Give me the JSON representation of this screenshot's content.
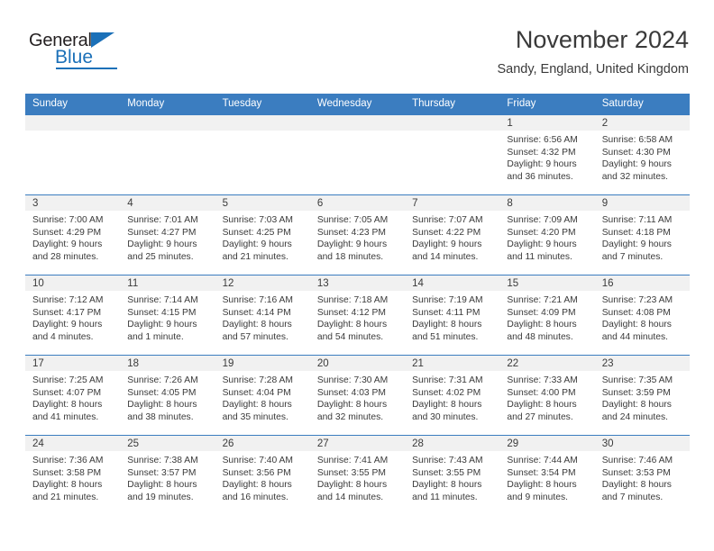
{
  "brand": {
    "name_top": "General",
    "name_bottom": "Blue",
    "accent_color": "#1b70b8",
    "triangle_icon": "blue-triangle-icon"
  },
  "header": {
    "title": "November 2024",
    "subtitle": "Sandy, England, United Kingdom"
  },
  "theme": {
    "header_bg": "#3b7dc0",
    "daynum_bg": "#f1f1f1",
    "text_color": "#3a3a3a",
    "row_divider": "#3b7dc0"
  },
  "weekday_headers": [
    "Sunday",
    "Monday",
    "Tuesday",
    "Wednesday",
    "Thursday",
    "Friday",
    "Saturday"
  ],
  "weeks": [
    [
      {
        "day": "",
        "sunrise": "",
        "sunset": "",
        "daylight_line1": "",
        "daylight_line2": "",
        "empty": true
      },
      {
        "day": "",
        "sunrise": "",
        "sunset": "",
        "daylight_line1": "",
        "daylight_line2": "",
        "empty": true
      },
      {
        "day": "",
        "sunrise": "",
        "sunset": "",
        "daylight_line1": "",
        "daylight_line2": "",
        "empty": true
      },
      {
        "day": "",
        "sunrise": "",
        "sunset": "",
        "daylight_line1": "",
        "daylight_line2": "",
        "empty": true
      },
      {
        "day": "",
        "sunrise": "",
        "sunset": "",
        "daylight_line1": "",
        "daylight_line2": "",
        "empty": true
      },
      {
        "day": "1",
        "sunrise": "Sunrise: 6:56 AM",
        "sunset": "Sunset: 4:32 PM",
        "daylight_line1": "Daylight: 9 hours",
        "daylight_line2": "and 36 minutes."
      },
      {
        "day": "2",
        "sunrise": "Sunrise: 6:58 AM",
        "sunset": "Sunset: 4:30 PM",
        "daylight_line1": "Daylight: 9 hours",
        "daylight_line2": "and 32 minutes."
      }
    ],
    [
      {
        "day": "3",
        "sunrise": "Sunrise: 7:00 AM",
        "sunset": "Sunset: 4:29 PM",
        "daylight_line1": "Daylight: 9 hours",
        "daylight_line2": "and 28 minutes."
      },
      {
        "day": "4",
        "sunrise": "Sunrise: 7:01 AM",
        "sunset": "Sunset: 4:27 PM",
        "daylight_line1": "Daylight: 9 hours",
        "daylight_line2": "and 25 minutes."
      },
      {
        "day": "5",
        "sunrise": "Sunrise: 7:03 AM",
        "sunset": "Sunset: 4:25 PM",
        "daylight_line1": "Daylight: 9 hours",
        "daylight_line2": "and 21 minutes."
      },
      {
        "day": "6",
        "sunrise": "Sunrise: 7:05 AM",
        "sunset": "Sunset: 4:23 PM",
        "daylight_line1": "Daylight: 9 hours",
        "daylight_line2": "and 18 minutes."
      },
      {
        "day": "7",
        "sunrise": "Sunrise: 7:07 AM",
        "sunset": "Sunset: 4:22 PM",
        "daylight_line1": "Daylight: 9 hours",
        "daylight_line2": "and 14 minutes."
      },
      {
        "day": "8",
        "sunrise": "Sunrise: 7:09 AM",
        "sunset": "Sunset: 4:20 PM",
        "daylight_line1": "Daylight: 9 hours",
        "daylight_line2": "and 11 minutes."
      },
      {
        "day": "9",
        "sunrise": "Sunrise: 7:11 AM",
        "sunset": "Sunset: 4:18 PM",
        "daylight_line1": "Daylight: 9 hours",
        "daylight_line2": "and 7 minutes."
      }
    ],
    [
      {
        "day": "10",
        "sunrise": "Sunrise: 7:12 AM",
        "sunset": "Sunset: 4:17 PM",
        "daylight_line1": "Daylight: 9 hours",
        "daylight_line2": "and 4 minutes."
      },
      {
        "day": "11",
        "sunrise": "Sunrise: 7:14 AM",
        "sunset": "Sunset: 4:15 PM",
        "daylight_line1": "Daylight: 9 hours",
        "daylight_line2": "and 1 minute."
      },
      {
        "day": "12",
        "sunrise": "Sunrise: 7:16 AM",
        "sunset": "Sunset: 4:14 PM",
        "daylight_line1": "Daylight: 8 hours",
        "daylight_line2": "and 57 minutes."
      },
      {
        "day": "13",
        "sunrise": "Sunrise: 7:18 AM",
        "sunset": "Sunset: 4:12 PM",
        "daylight_line1": "Daylight: 8 hours",
        "daylight_line2": "and 54 minutes."
      },
      {
        "day": "14",
        "sunrise": "Sunrise: 7:19 AM",
        "sunset": "Sunset: 4:11 PM",
        "daylight_line1": "Daylight: 8 hours",
        "daylight_line2": "and 51 minutes."
      },
      {
        "day": "15",
        "sunrise": "Sunrise: 7:21 AM",
        "sunset": "Sunset: 4:09 PM",
        "daylight_line1": "Daylight: 8 hours",
        "daylight_line2": "and 48 minutes."
      },
      {
        "day": "16",
        "sunrise": "Sunrise: 7:23 AM",
        "sunset": "Sunset: 4:08 PM",
        "daylight_line1": "Daylight: 8 hours",
        "daylight_line2": "and 44 minutes."
      }
    ],
    [
      {
        "day": "17",
        "sunrise": "Sunrise: 7:25 AM",
        "sunset": "Sunset: 4:07 PM",
        "daylight_line1": "Daylight: 8 hours",
        "daylight_line2": "and 41 minutes."
      },
      {
        "day": "18",
        "sunrise": "Sunrise: 7:26 AM",
        "sunset": "Sunset: 4:05 PM",
        "daylight_line1": "Daylight: 8 hours",
        "daylight_line2": "and 38 minutes."
      },
      {
        "day": "19",
        "sunrise": "Sunrise: 7:28 AM",
        "sunset": "Sunset: 4:04 PM",
        "daylight_line1": "Daylight: 8 hours",
        "daylight_line2": "and 35 minutes."
      },
      {
        "day": "20",
        "sunrise": "Sunrise: 7:30 AM",
        "sunset": "Sunset: 4:03 PM",
        "daylight_line1": "Daylight: 8 hours",
        "daylight_line2": "and 32 minutes."
      },
      {
        "day": "21",
        "sunrise": "Sunrise: 7:31 AM",
        "sunset": "Sunset: 4:02 PM",
        "daylight_line1": "Daylight: 8 hours",
        "daylight_line2": "and 30 minutes."
      },
      {
        "day": "22",
        "sunrise": "Sunrise: 7:33 AM",
        "sunset": "Sunset: 4:00 PM",
        "daylight_line1": "Daylight: 8 hours",
        "daylight_line2": "and 27 minutes."
      },
      {
        "day": "23",
        "sunrise": "Sunrise: 7:35 AM",
        "sunset": "Sunset: 3:59 PM",
        "daylight_line1": "Daylight: 8 hours",
        "daylight_line2": "and 24 minutes."
      }
    ],
    [
      {
        "day": "24",
        "sunrise": "Sunrise: 7:36 AM",
        "sunset": "Sunset: 3:58 PM",
        "daylight_line1": "Daylight: 8 hours",
        "daylight_line2": "and 21 minutes."
      },
      {
        "day": "25",
        "sunrise": "Sunrise: 7:38 AM",
        "sunset": "Sunset: 3:57 PM",
        "daylight_line1": "Daylight: 8 hours",
        "daylight_line2": "and 19 minutes."
      },
      {
        "day": "26",
        "sunrise": "Sunrise: 7:40 AM",
        "sunset": "Sunset: 3:56 PM",
        "daylight_line1": "Daylight: 8 hours",
        "daylight_line2": "and 16 minutes."
      },
      {
        "day": "27",
        "sunrise": "Sunrise: 7:41 AM",
        "sunset": "Sunset: 3:55 PM",
        "daylight_line1": "Daylight: 8 hours",
        "daylight_line2": "and 14 minutes."
      },
      {
        "day": "28",
        "sunrise": "Sunrise: 7:43 AM",
        "sunset": "Sunset: 3:55 PM",
        "daylight_line1": "Daylight: 8 hours",
        "daylight_line2": "and 11 minutes."
      },
      {
        "day": "29",
        "sunrise": "Sunrise: 7:44 AM",
        "sunset": "Sunset: 3:54 PM",
        "daylight_line1": "Daylight: 8 hours",
        "daylight_line2": "and 9 minutes."
      },
      {
        "day": "30",
        "sunrise": "Sunrise: 7:46 AM",
        "sunset": "Sunset: 3:53 PM",
        "daylight_line1": "Daylight: 8 hours",
        "daylight_line2": "and 7 minutes."
      }
    ]
  ]
}
